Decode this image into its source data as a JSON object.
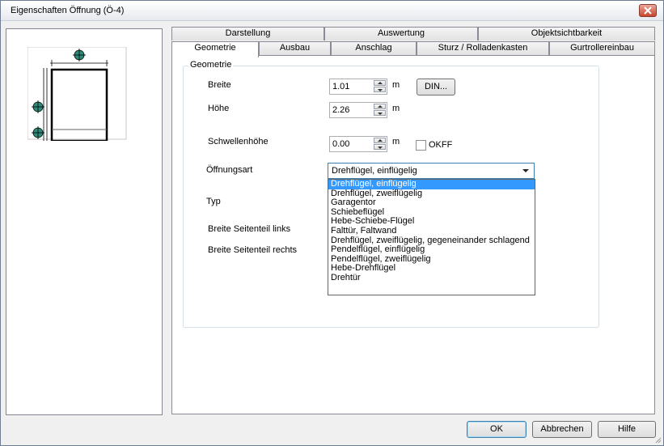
{
  "window": {
    "title": "Eigenschaften Öffnung (Ö-4)"
  },
  "tabs_row1": [
    "Darstellung",
    "Auswertung",
    "Objektsichtbarkeit"
  ],
  "tabs_row2": [
    "Geometrie",
    "Ausbau",
    "Anschlag",
    "Sturz / Rolladenkasten",
    "Gurtrollereinbau"
  ],
  "active_tab": "Geometrie",
  "group": {
    "title": "Geometrie"
  },
  "fields": {
    "breite": {
      "label": "Breite",
      "value": "1.01",
      "unit": "m"
    },
    "hoehe": {
      "label": "Höhe",
      "value": "2.26",
      "unit": "m"
    },
    "schwelle": {
      "label": "Schwellenhöhe",
      "value": "0.00",
      "unit": "m"
    },
    "okff_label": "OKFF",
    "din_button": "DIN...",
    "oeffnungsart": {
      "label": "Öffnungsart",
      "selected": "Drehflügel, einflügelig"
    },
    "typ_label": "Typ",
    "seitenteil_links_label": "Breite Seitenteil links",
    "seitenteil_rechts_label": "Breite Seitenteil rechts"
  },
  "dropdown_options": [
    "Drehflügel, einflügelig",
    "Drehflügel, zweiflügelig",
    "Garagentor",
    "Schiebeflügel",
    "Hebe-Schiebe-Flügel",
    "Falttür, Faltwand",
    "Drehflügel, zweiflügelig, gegeneinander schlagend",
    "Pendelflügel, einflügelig",
    "Pendelflügel, zweiflügelig",
    "Hebe-Drehflügel",
    "Drehtür"
  ],
  "buttons": {
    "ok": "OK",
    "cancel": "Abbrechen",
    "help": "Hilfe"
  },
  "colors": {
    "accent": "#3399ff",
    "close_red": "#c7442f",
    "marker_teal": "#2e8b7a"
  }
}
